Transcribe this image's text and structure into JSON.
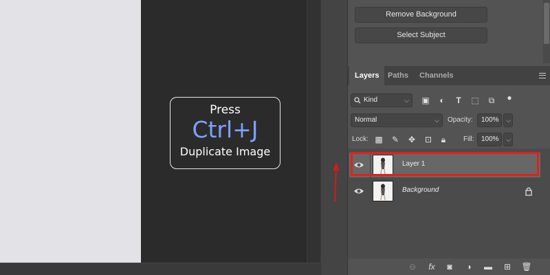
{
  "tip": {
    "press": "Press",
    "keys": "Ctrl+J",
    "action": "Duplicate Image"
  },
  "properties": {
    "remove_bg_label": "Remove Background",
    "select_subject_label": "Select Subject"
  },
  "tabs": [
    {
      "label": "Layers",
      "active": true
    },
    {
      "label": "Paths",
      "active": false
    },
    {
      "label": "Channels",
      "active": false
    }
  ],
  "filter": {
    "kind_label": "Kind"
  },
  "blend": {
    "mode": "Normal",
    "opacity_label": "Opacity:",
    "opacity_value": "100%"
  },
  "lock": {
    "label": "Lock:",
    "fill_label": "Fill:",
    "fill_value": "100%"
  },
  "layers": [
    {
      "name": "Layer 1",
      "selected": true,
      "italic": false
    },
    {
      "name": "Background",
      "selected": false,
      "italic": true,
      "locked": true
    }
  ],
  "colors": {
    "accent_key": "#7da2ff",
    "highlight": "#e0211b"
  }
}
